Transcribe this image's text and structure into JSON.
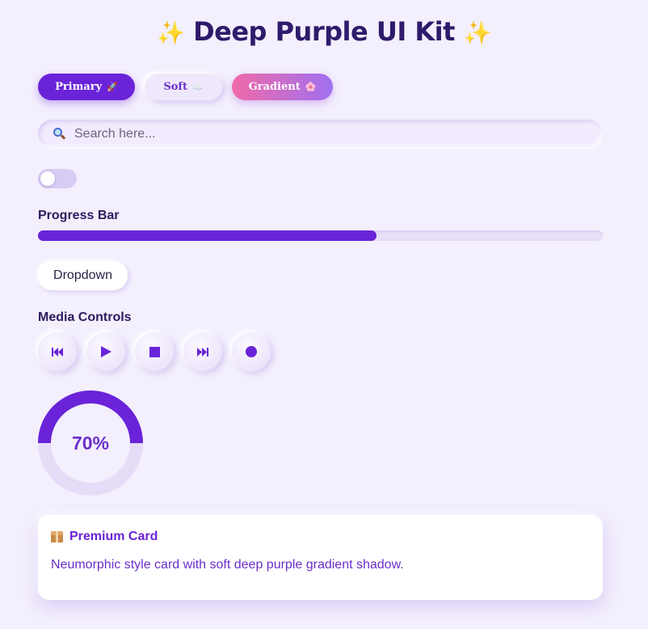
{
  "header": {
    "title": "Deep Purple UI Kit",
    "left_icon": "sparkles",
    "right_icon": "sparkles"
  },
  "buttons": [
    {
      "label": "Primary",
      "emoji": "🚀",
      "variant": "primary"
    },
    {
      "label": "Soft",
      "emoji": "☁️",
      "variant": "soft"
    },
    {
      "label": "Gradient",
      "emoji": "🌸",
      "variant": "gradient"
    }
  ],
  "search": {
    "placeholder": "Search here...",
    "value": "",
    "icon": "magnifier"
  },
  "toggle": {
    "on": false
  },
  "progress": {
    "label": "Progress Bar",
    "percent": 60
  },
  "dropdown": {
    "label": "Dropdown"
  },
  "media": {
    "label": "Media Controls",
    "controls": [
      "previous",
      "play",
      "stop",
      "next",
      "record"
    ]
  },
  "gauge": {
    "value": 70,
    "text": "70%"
  },
  "card": {
    "icon": "package",
    "title": "Premium Card",
    "text": "Neumorphic style card with soft deep purple gradient shadow."
  },
  "colors": {
    "background": "#f3effd",
    "accent": "#6a23d8",
    "gradient_start": "#f06aa8",
    "gradient_end": "#a070f0",
    "track": "#e8e0f8"
  }
}
